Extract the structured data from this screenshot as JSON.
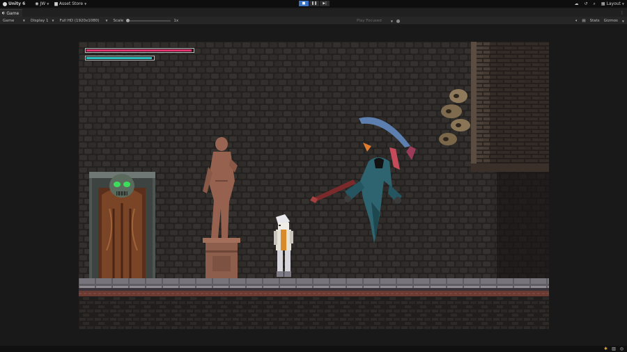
{
  "toolbar": {
    "app_title": "Unity 6",
    "account_label": "JW",
    "asset_store_label": "Asset Store",
    "layout_label": "Layout",
    "icons": {
      "logo": "unity-logo-icon",
      "account": "account-icon",
      "asset_store": "asset-store-icon",
      "cloud": "cloud-icon",
      "history": "history-icon",
      "search": "search-icon",
      "layout": "layout-icon"
    }
  },
  "playmode": {
    "play": "play-icon",
    "pause": "pause-icon",
    "step": "step-icon",
    "active": "play"
  },
  "tab": {
    "label": "Game",
    "icon": "gamepad-icon"
  },
  "gamebar": {
    "view_mode": "Game",
    "display": "Display 1",
    "resolution": "Full HD (1920x1080)",
    "scale_label": "Scale",
    "scale_value": "1x",
    "play_focused": "Play Focused",
    "stats_label": "Stats",
    "gizmos_label": "Gizmos",
    "icons": {
      "audio": "speaker-icon",
      "stats_toggle": "grid-icon"
    }
  },
  "hud": {
    "health_fraction": 0.99,
    "mana_fraction": 0.98,
    "health_color": "#e0326e",
    "mana_color": "#2fc0c0"
  },
  "colors": {
    "accent_play": "#3a72c6",
    "editor_bg": "#191919",
    "ghost_cloak": "#2d6470",
    "skull_eyes": "#3ddc5a"
  },
  "statusbar": {
    "icons": [
      "bug-icon",
      "clipboard-icon",
      "network-icon"
    ]
  }
}
